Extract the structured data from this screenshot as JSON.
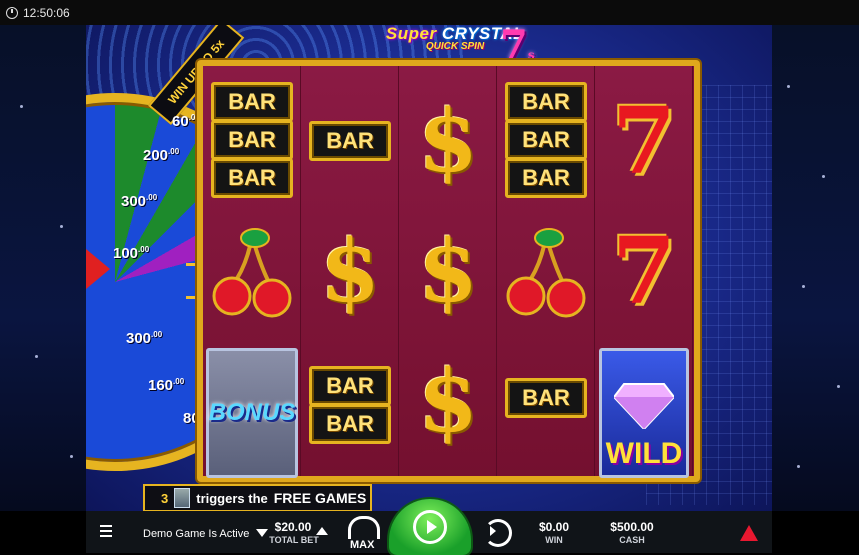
{
  "status_bar": {
    "time": "12:50:06"
  },
  "logo": {
    "super": "Super",
    "crystal": "CRYSTAL",
    "quick_spin": "QUICK SPIN",
    "seven": "7",
    "seven_suffix": "s"
  },
  "wheel": {
    "banner": "WIN UP TO 5x",
    "labels": [
      {
        "main": "60",
        "dec": ".00"
      },
      {
        "main": "200",
        "dec": ".00"
      },
      {
        "main": "300",
        "dec": ".00"
      },
      {
        "main": "100",
        "dec": ".00"
      },
      {
        "main": "300",
        "dec": ".00"
      },
      {
        "main": "160",
        "dec": ".00"
      },
      {
        "main": "80",
        "dec": ""
      }
    ]
  },
  "reels": [
    [
      {
        "type": "bar",
        "label": "BAR"
      },
      {
        "type": "bar",
        "label": "BAR"
      },
      {
        "type": "bar",
        "label": "BAR"
      },
      {
        "type": "cherry"
      },
      {
        "type": "bonus",
        "label": "BONUS"
      }
    ],
    [
      {
        "type": "bar",
        "label": "BAR"
      },
      {
        "type": "dollar",
        "label": "$"
      },
      {
        "type": "bar",
        "label": "BAR"
      },
      {
        "type": "bar",
        "label": "BAR"
      }
    ],
    [
      {
        "type": "dollar",
        "label": "$"
      },
      {
        "type": "dollar",
        "label": "$"
      },
      {
        "type": "dollar",
        "label": "$"
      }
    ],
    [
      {
        "type": "bar",
        "label": "BAR"
      },
      {
        "type": "bar",
        "label": "BAR"
      },
      {
        "type": "bar",
        "label": "BAR"
      },
      {
        "type": "cherry"
      },
      {
        "type": "bar",
        "label": "BAR"
      }
    ],
    [
      {
        "type": "seven",
        "label": "7"
      },
      {
        "type": "seven",
        "label": "7"
      },
      {
        "type": "wild",
        "label": "WILD"
      }
    ]
  ],
  "trigger": {
    "count": "3",
    "text": "triggers the",
    "games": "FREE GAMES"
  },
  "bottom_bar": {
    "demo_text": "Demo Game Is Active",
    "total_bet_value": "$20.00",
    "total_bet_label": "TOTAL BET",
    "max_label": "MAX",
    "win_value": "$0.00",
    "win_label": "WIN",
    "cash_value": "$500.00",
    "cash_label": "CASH"
  },
  "colors": {
    "frame_gold": "#e0a81c",
    "reel_bg": "#7a1236",
    "spin_green": "#1aa02a",
    "stage_blue": "#1a2a8c"
  }
}
